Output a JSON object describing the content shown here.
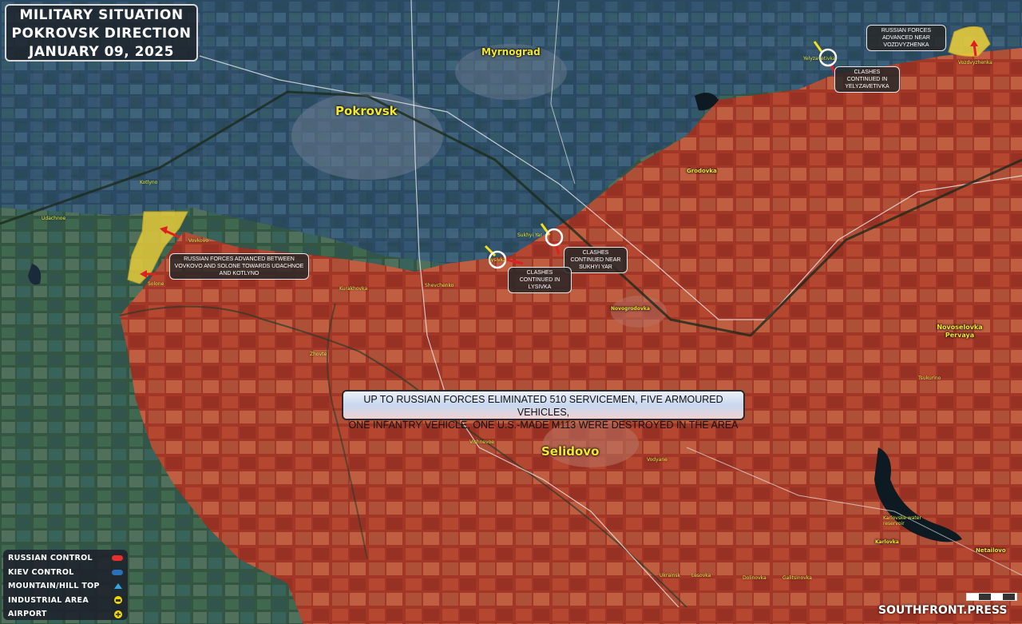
{
  "title": {
    "line1": "MILITARY SITUATION",
    "line2": "POKROVSK DIRECTION",
    "date": "JANUARY 09, 2025"
  },
  "cities": {
    "pokrovsk": "Pokrovsk",
    "myrnograd": "Myrnograd",
    "selidovo": "Selidovo",
    "novoselovka_pervaya": "Novoselovka Pervaya",
    "grodovka": "Grodovka",
    "karlovka": "Karlovka",
    "netailovo": "Netailovo",
    "novogrodovka": "Novogrodovka"
  },
  "villages": {
    "udachnoe": "Udachnoe",
    "kotlyno": "Kotlyno",
    "solone": "Solone",
    "vovkovo": "Vovkovo",
    "lysivka": "Lysivka",
    "sukhyi_yar": "Sukhyi Yar",
    "yelyzavetivka": "Yelyzavetivka",
    "vozdvyzhenka": "Vozdvyzhenka",
    "shevchenko": "Shevchenko",
    "zhovte": "Zhovte",
    "vishnevoe": "Vishnevoe",
    "kurakhovka": "Kurakhovka",
    "vodyane": "Vodyane",
    "ukrainsk": "Ukrainsk",
    "lesovka": "Lesovka",
    "dolinovka": "Dolinovka",
    "galitsinovka": "Galitsinovka",
    "tsukurino": "Tsukurino",
    "karlovske_reservoir": "Karlovske water reservoir"
  },
  "notes": {
    "vozdvyzhenka": "RUSSIAN FORCES ADVANCED NEAR VOZDVYZHENKA",
    "yelyzavetivka": "CLASHES CONTINUED IN YELYZAVETIVKA",
    "sukhyi_yar": "CLASHES CONTINUED NEAR SUKHYI YAR",
    "lysivka": "CLASHES CONTINUED IN LYSIVKA",
    "vovkovo": "RUSSIAN FORCES ADVANCED BETWEEN VOVKOVO AND SOLONE TOWARDS UDACHNOE AND KOTLYNO"
  },
  "banner": {
    "line1": "UP TO RUSSIAN FORCES ELIMINATED 510 SERVICEMEN, FIVE ARMOURED VEHICLES,",
    "line2": "ONE INFANTRY VEHICLE, ONE U.S.-MADE M113 WERE DESTROYED IN THE AREA"
  },
  "legend": [
    {
      "label": "RUSSIAN CONTROL",
      "icon": "red-swatch",
      "color": "#e8302a"
    },
    {
      "label": "KIEV CONTROL",
      "icon": "blue-swatch",
      "color": "#2a6fb8"
    },
    {
      "label": "MOUNTAIN/HILL TOP",
      "icon": "mountain-icon",
      "color": "#2fa8e0"
    },
    {
      "label": "INDUSTRIAL AREA",
      "icon": "industrial-icon",
      "color": "#f0d800"
    },
    {
      "label": "AIRPORT",
      "icon": "airport-icon",
      "color": "#f0d800"
    }
  ],
  "brand": "SOUTHFRONT.PRESS",
  "colors": {
    "russian_control": "#b8402a",
    "kiev_control": "#2a5f9a",
    "advance_zone": "#f0d23a",
    "arrow_red": "#e02020",
    "arrow_yellow": "#f0e020",
    "label_yellow": "#f3e830"
  }
}
